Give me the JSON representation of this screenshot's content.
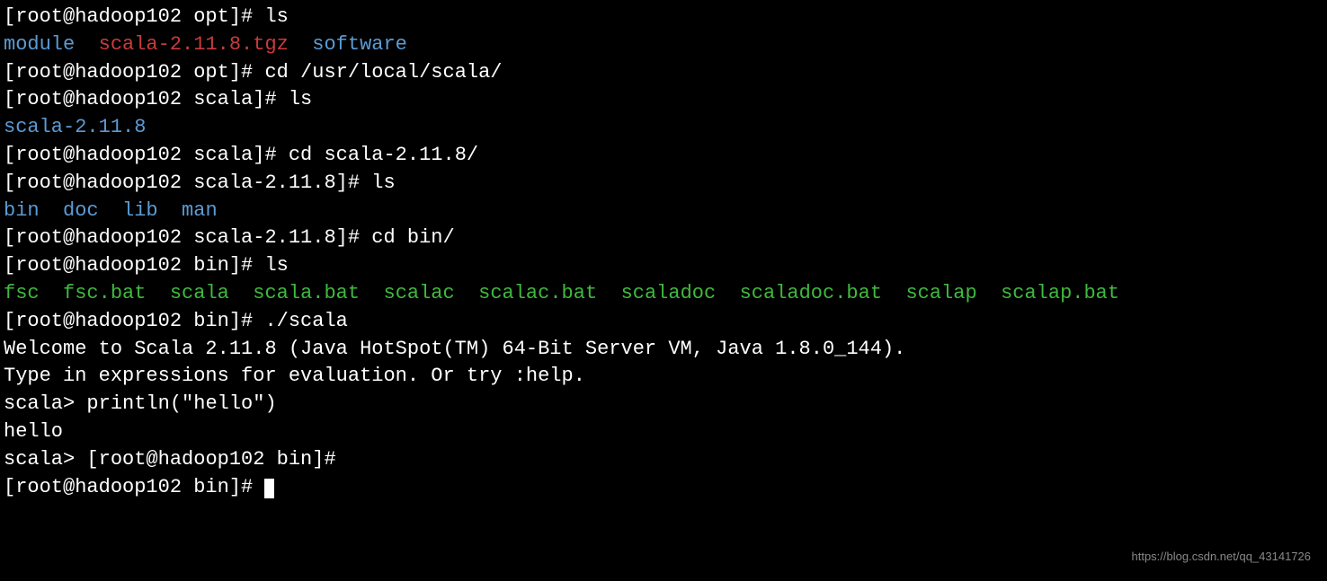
{
  "lines": {
    "l1_prompt": "[root@hadoop102 opt]# ",
    "l1_cmd": "ls",
    "l2_module": "module",
    "l2_gap1": "  ",
    "l2_tgz": "scala-2.11.8.tgz",
    "l2_gap2": "  ",
    "l2_software": "software",
    "l3_prompt": "[root@hadoop102 opt]# ",
    "l3_cmd": "cd /usr/local/scala/",
    "l4_prompt": "[root@hadoop102 scala]# ",
    "l4_cmd": "ls",
    "l5_dir": "scala-2.11.8",
    "l6_prompt": "[root@hadoop102 scala]# ",
    "l6_cmd": "cd scala-2.11.8/",
    "l7_prompt": "[root@hadoop102 scala-2.11.8]# ",
    "l7_cmd": "ls",
    "l8_bin": "bin",
    "l8_gap1": "  ",
    "l8_doc": "doc",
    "l8_gap2": "  ",
    "l8_lib": "lib",
    "l8_gap3": "  ",
    "l8_man": "man",
    "l9_prompt": "[root@hadoop102 scala-2.11.8]# ",
    "l9_cmd": "cd bin/",
    "l10_prompt": "[root@hadoop102 bin]# ",
    "l10_cmd": "ls",
    "l11_fsc": "fsc",
    "l11_g1": "  ",
    "l11_fscbat": "fsc.bat",
    "l11_g2": "  ",
    "l11_scala": "scala",
    "l11_g3": "  ",
    "l11_scalabat": "scala.bat",
    "l11_g4": "  ",
    "l11_scalac": "scalac",
    "l11_g5": "  ",
    "l11_scalacbat": "scalac.bat",
    "l11_g6": "  ",
    "l11_scaladoc": "scaladoc",
    "l11_g7": "  ",
    "l11_scaladocbat": "scaladoc.bat",
    "l11_g8": "  ",
    "l11_scalap": "scalap",
    "l11_g9": "  ",
    "l11_scalapbat": "scalap.bat",
    "l12_prompt": "[root@hadoop102 bin]# ",
    "l12_cmd": "./scala",
    "l13": "Welcome to Scala 2.11.8 (Java HotSpot(TM) 64-Bit Server VM, Java 1.8.0_144).",
    "l14": "Type in expressions for evaluation. Or try :help.",
    "l15": "",
    "l16_prompt": "scala> ",
    "l16_cmd": "println(\"hello\")",
    "l17": "hello",
    "l18": "",
    "l19_prompt": "scala> ",
    "l19_prompt2": "[root@hadoop102 bin]# ",
    "l20_prompt": "[root@hadoop102 bin]# "
  },
  "watermark": "https://blog.csdn.net/qq_43141726"
}
